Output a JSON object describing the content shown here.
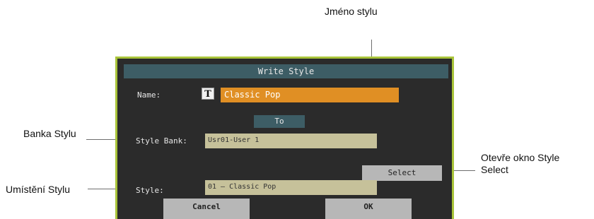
{
  "annotations": {
    "style_name": "Jméno stylu",
    "style_bank": "Banka Stylu",
    "style_location": "Umístění Stylu",
    "opens_select_line1": "Otevře okno Style",
    "opens_select_line2": "Select"
  },
  "dialog": {
    "title": "Write Style",
    "name_label": "Name:",
    "text_icon_glyph": "T",
    "name_value": "Classic Pop",
    "to_label": "To",
    "style_bank_label": "Style Bank:",
    "style_bank_value": "Usr01-User 1",
    "style_label": "Style:",
    "style_value": "01 – Classic Pop",
    "select_button": "Select",
    "cancel_button": "Cancel",
    "ok_button": "OK"
  },
  "colors": {
    "frame_border": "#a9c43a",
    "dialog_bg": "#2b2b2b",
    "titlebar_bg": "#3d5d65",
    "name_field_bg": "#e08f24",
    "field_bg": "#c6c19a",
    "button_bg": "#b7b7b7"
  }
}
